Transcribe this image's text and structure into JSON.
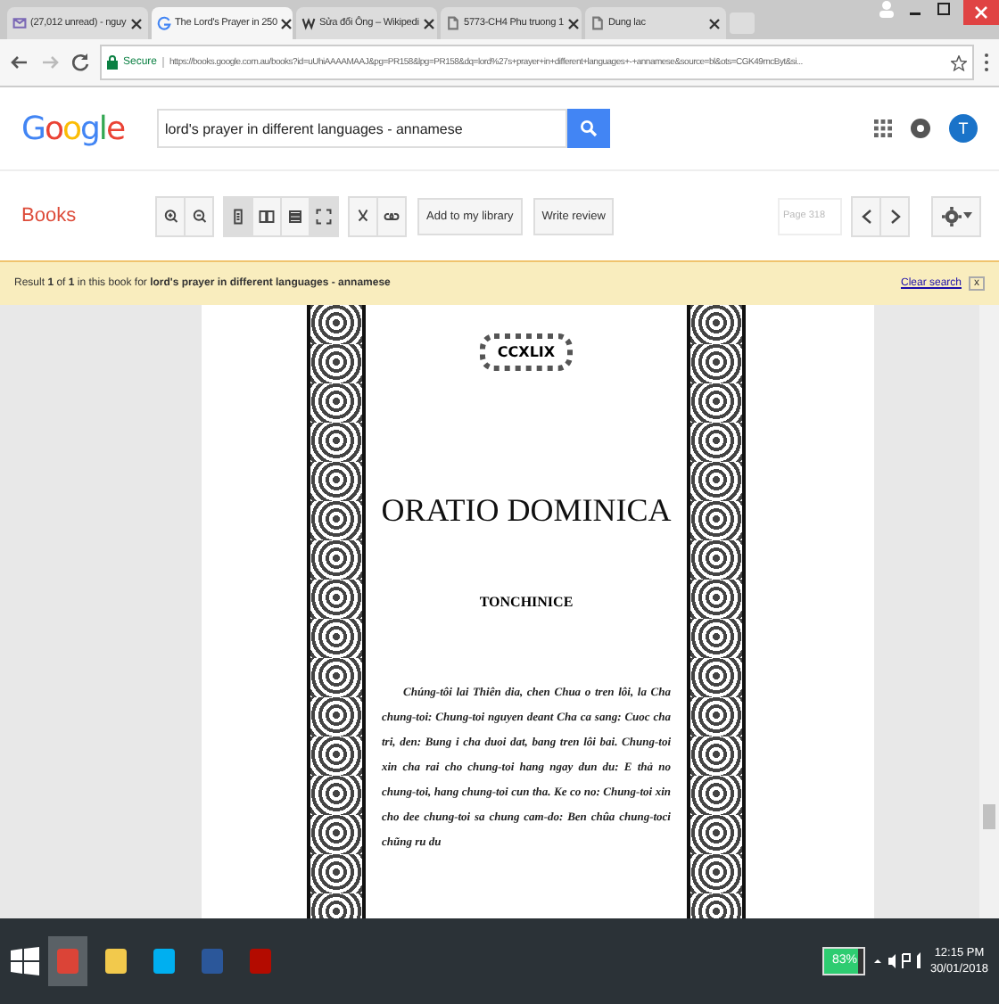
{
  "browser": {
    "tabs": [
      {
        "title": "(27,012 unread) - nguy",
        "kind": "mail",
        "selected": false
      },
      {
        "title": "The Lord's Prayer in 250",
        "kind": "google",
        "selected": true
      },
      {
        "title": "Sửa đổi Ông – Wikipedi",
        "kind": "wiki",
        "selected": false
      },
      {
        "title": "5773-CH4 Phu truong 1",
        "kind": "doc",
        "selected": false
      },
      {
        "title": "Dung lac",
        "kind": "doc",
        "selected": false
      }
    ],
    "secure_label": "Secure",
    "url": "https://books.google.com.au/books?id=uUhiAAAAMAAJ&pg=PR158&lpg=PR158&dq=lord%27s+prayer+in+different+languages+-+annamese&source=bl&ots=CGK49mcByt&si..."
  },
  "header": {
    "logo": "Google",
    "search_value": "lord's prayer in different languages - annamese",
    "avatar_letter": "T"
  },
  "toolbar": {
    "section": "Books",
    "view_buttons": [
      {
        "kind": "zoomin",
        "selected": false
      },
      {
        "kind": "zoomout",
        "selected": false
      },
      {
        "kind": "page",
        "selected": true
      },
      {
        "kind": "twopage",
        "selected": false
      },
      {
        "kind": "thumbs",
        "selected": false
      },
      {
        "kind": "fullscreen",
        "selected": true
      },
      {
        "kind": "clip",
        "selected": false
      },
      {
        "kind": "link",
        "selected": false
      }
    ],
    "text_buttons": [
      "Add to my library",
      "Write review"
    ],
    "page_value": "Page 318"
  },
  "result_bar": {
    "text": "Result **1** of **1** in this book for **lord's prayer in different languages - annamese**",
    "clear_link": "Clear search",
    "close": "x"
  },
  "book_page": {
    "number": "CCXLIX",
    "title": "ORATIO DOMINICA",
    "subtitle": "TONCHINICE",
    "paragraph": "Chúng-tôi lai Thiên dia, chen Chua o tren lôi, la Cha chung-toi: Chung-toi nguyen deant Cha ca sang: Cuoc cha tri, den: Bung i cha duoi dat, bang tren lôi bai. Chung-toi xin cha rai cho chung-toi hang ngay dun du: E thả no chung-toi, hang chung-toi cun tha. Ke co no: Chung-toi xin cho dee chung-toi sa chung cam-do: Ben chûa chung-toci chũng ru du"
  },
  "taskbar": {
    "apps": [
      {
        "kind": "chrome",
        "selected": true
      },
      {
        "kind": "explorer",
        "selected": false
      },
      {
        "kind": "skype",
        "selected": false
      },
      {
        "kind": "word",
        "selected": false
      },
      {
        "kind": "acrobat",
        "selected": false
      }
    ],
    "battery": {
      "level": 0.83,
      "text": "83%"
    },
    "time": "12:15 PM",
    "date": "30/01/2018"
  }
}
